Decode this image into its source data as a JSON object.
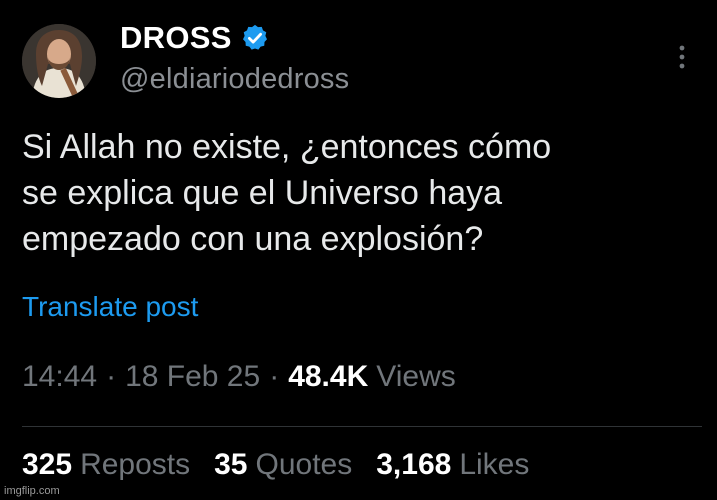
{
  "author": {
    "display_name": "DROSS",
    "handle": "@eldiariodedross",
    "avatar_icon": "avatar-photo",
    "verified_icon": "verified-badge-icon",
    "verified_color": "#1d9bf0"
  },
  "post": {
    "text": "Si Allah no existe, ¿entonces cómo\nse explica que el Universo haya\nempezado con una explosión?",
    "translate_label": "Translate post",
    "time": "14:44",
    "date": "18 Feb 25",
    "views_count": "48.4K",
    "views_label": "Views",
    "separator": "·"
  },
  "stats": {
    "reposts_count": "325",
    "reposts_label": "Reposts",
    "quotes_count": "35",
    "quotes_label": "Quotes",
    "likes_count": "3,168",
    "likes_label": "Likes"
  },
  "watermark": "imgflip.com",
  "colors": {
    "background": "#000000",
    "text": "#e7e9ea",
    "secondary_text": "#71767b",
    "link": "#1d9bf0",
    "divider": "#2f3336"
  }
}
